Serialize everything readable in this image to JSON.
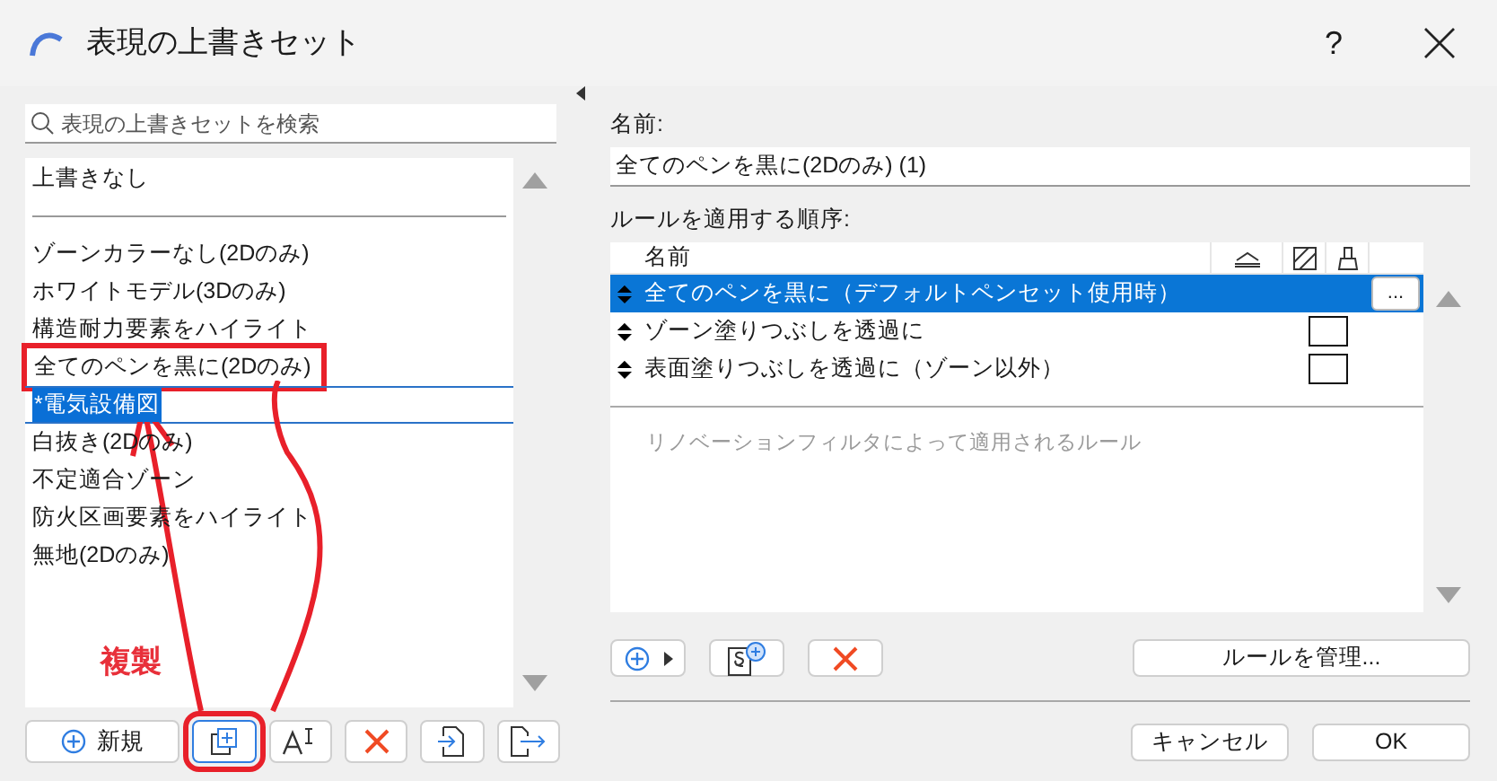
{
  "window": {
    "title": "表現の上書きセット",
    "help": "?"
  },
  "left_panel": {
    "search": {
      "placeholder": "表現の上書きセットを検索"
    },
    "list": [
      {
        "label": "上書きなし",
        "kind": "item",
        "selected": false,
        "highlighted": false
      },
      {
        "kind": "divider"
      },
      {
        "label": "ゾーンカラーなし(2Dのみ)",
        "kind": "item",
        "selected": false,
        "highlighted": false
      },
      {
        "label": "ホワイトモデル(3Dのみ)",
        "kind": "item",
        "selected": false,
        "highlighted": false
      },
      {
        "label": "構造耐力要素をハイライト",
        "kind": "item",
        "selected": false,
        "highlighted": false
      },
      {
        "label": "全てのペンを黒に(2Dのみ)",
        "kind": "item",
        "selected": false,
        "highlighted": true
      },
      {
        "label": "*電気設備図",
        "kind": "edit",
        "selected": true,
        "highlighted": false
      },
      {
        "label": "白抜き(2Dのみ)",
        "kind": "item",
        "selected": false,
        "highlighted": false
      },
      {
        "label": "不定適合ゾーン",
        "kind": "item",
        "selected": false,
        "highlighted": false
      },
      {
        "label": "防火区画要素をハイライト",
        "kind": "item",
        "selected": false,
        "highlighted": false
      },
      {
        "label": "無地(2Dのみ)",
        "kind": "item",
        "selected": false,
        "highlighted": false
      }
    ],
    "buttons": [
      {
        "kind": "new",
        "label": "新規",
        "highlighted": false
      },
      {
        "kind": "duplicate",
        "highlighted": true
      },
      {
        "kind": "rename",
        "highlighted": false
      },
      {
        "kind": "delete",
        "highlighted": false
      },
      {
        "kind": "import",
        "highlighted": false
      },
      {
        "kind": "export",
        "highlighted": false
      }
    ],
    "annotation": {
      "label": "複製"
    }
  },
  "right_panel": {
    "name_label": "名前:",
    "name_value": "全てのペンを黒に(2Dのみ) (1)",
    "rules_label": "ルールを適用する順序:",
    "table": {
      "columns": [
        {
          "kind": "text",
          "label": "名前"
        },
        {
          "kind": "line-icon"
        },
        {
          "kind": "fill-icon"
        },
        {
          "kind": "brush-icon"
        }
      ],
      "rows": [
        {
          "name": "全てのペンを黒に（デフォルトペンセット使用時）",
          "selected": true,
          "kind": "action",
          "action": "..."
        },
        {
          "name": "ゾーン塗りつぶしを透過に",
          "selected": false,
          "kind": "checkbox",
          "checked": false
        },
        {
          "name": "表面塗りつぶしを透過に（ゾーン以外）",
          "selected": false,
          "kind": "checkbox",
          "checked": false
        }
      ],
      "renovation_label": "リノベーションフィルタによって適用されるルール"
    },
    "buttons": [
      {
        "kind": "add-menu"
      },
      {
        "kind": "add-rule"
      },
      {
        "kind": "delete"
      },
      {
        "kind": "text",
        "label": "ルールを管理..."
      }
    ]
  },
  "footer": {
    "buttons": [
      "キャンセル",
      "OK"
    ]
  }
}
